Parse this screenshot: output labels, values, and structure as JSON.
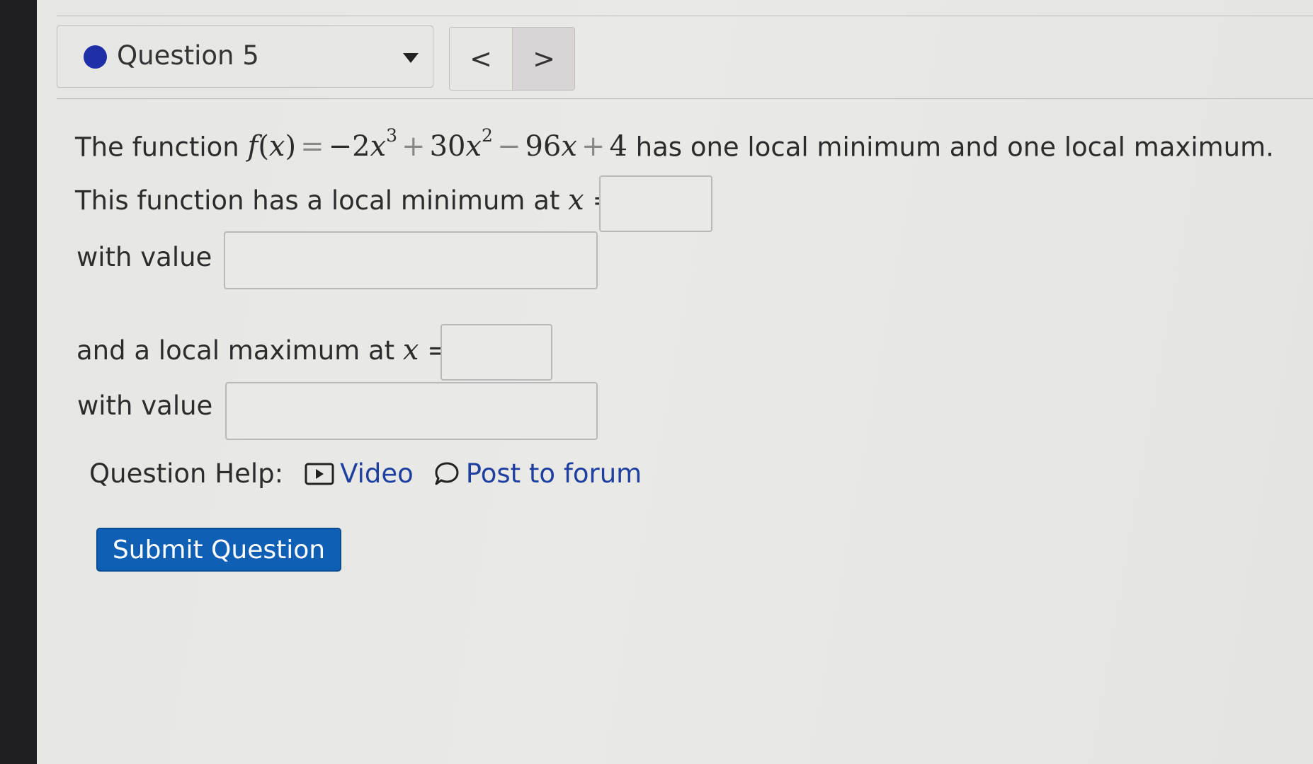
{
  "question_selector": {
    "label": "Question 5",
    "status_color": "#1f2fa7"
  },
  "nav": {
    "prev_glyph": "<",
    "next_glyph": ">"
  },
  "problem": {
    "intro": "The function",
    "function_name": "f",
    "function_var": "x",
    "eq": "=",
    "term1_coef": "−2",
    "term1_var": "x",
    "term1_exp": "3",
    "plus1": "+",
    "term2_coef": "30",
    "term2_var": "x",
    "term2_exp": "2",
    "minus1": "−",
    "term3_coef": "96",
    "term3_var": "x",
    "plus2": "+",
    "term4": "4",
    "statement_end": "has one local minimum and one local maximum.",
    "min_prompt": "This function has a local minimum at",
    "min_var": "x",
    "min_eq": "=",
    "min_value_label": "with value",
    "max_prompt": "and a local maximum at",
    "max_var": "x",
    "max_eq": "=",
    "max_value_label": "with value"
  },
  "inputs": {
    "min_x": "",
    "min_value": "",
    "max_x": "",
    "max_value": ""
  },
  "help": {
    "label": "Question Help:",
    "video": "Video",
    "forum": "Post to forum",
    "link_color": "#1f3fa0"
  },
  "submit": {
    "label": "Submit Question",
    "color": "#0f5fb5"
  }
}
